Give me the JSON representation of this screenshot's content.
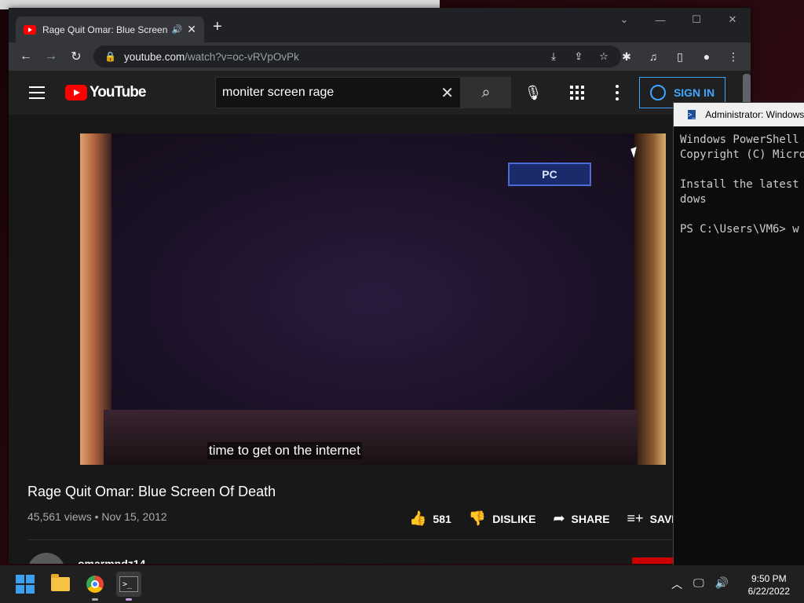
{
  "browser": {
    "tab_title": "Rage Quit Omar: Blue Screen",
    "url_host": "youtube.com",
    "url_path": "/watch?v=oc-vRVpOvPk"
  },
  "youtube": {
    "logo_text": "YouTube",
    "search_query": "moniter screen rage",
    "signin_label": "SIGN IN",
    "video": {
      "osd_label": "PC",
      "caption": "time to get on the internet",
      "title": "Rage Quit Omar: Blue Screen Of Death",
      "meta": "45,561 views • Nov 15, 2012",
      "likes": "581",
      "dislike_label": "DISLIKE",
      "share_label": "SHARE",
      "save_label": "SAVE"
    },
    "channel_name": "omarmndz14"
  },
  "powershell": {
    "title": "Administrator: Windows PowerShell",
    "lines": "Windows PowerShell\nCopyright (C) Microsoft Corporation.\n\nInstall the latest PowerShell for new features and improvements! https://aka.ms/PSWindows\ndows\n\nPS C:\\Users\\VM6> w"
  },
  "taskbar": {
    "time": "9:50 PM",
    "date": "6/22/2022"
  },
  "colors": {
    "youtube_red": "#ff0000",
    "link_blue": "#3ea6ff",
    "dark_bg": "#181818"
  }
}
